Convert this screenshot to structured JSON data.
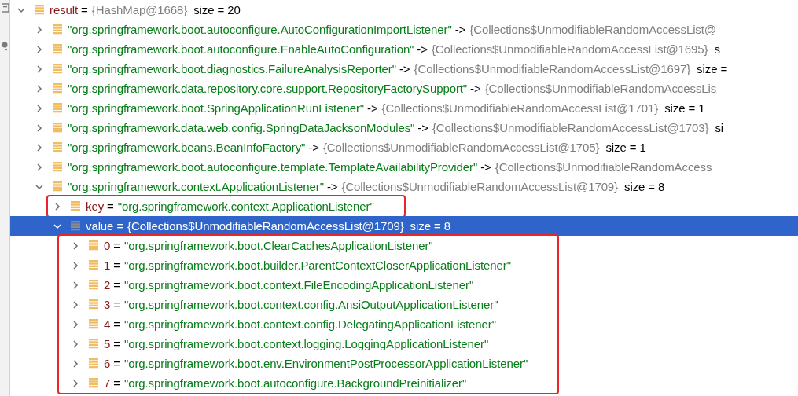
{
  "tree": {
    "name": "result",
    "kind": "object",
    "separator": "=",
    "value": "{HashMap@1668}",
    "size": "size = 20",
    "expanded": true,
    "selected": false,
    "highlighted": false,
    "children_highlighted": false,
    "children": [
      {
        "name": "\"org.springframework.boot.autoconfigure.AutoConfigurationImportListener\"",
        "kind": "entry",
        "separator": "->",
        "value": "{Collections$UnmodifiableRandomAccessList@",
        "expanded": false,
        "selected": false,
        "highlighted": false
      },
      {
        "name": "\"org.springframework.boot.autoconfigure.EnableAutoConfiguration\"",
        "kind": "entry",
        "separator": "->",
        "value": "{Collections$UnmodifiableRandomAccessList@1695}",
        "size": "s",
        "expanded": false,
        "selected": false,
        "highlighted": false
      },
      {
        "name": "\"org.springframework.boot.diagnostics.FailureAnalysisReporter\"",
        "kind": "entry",
        "separator": "->",
        "value": "{Collections$UnmodifiableRandomAccessList@1697}",
        "size": "size =",
        "expanded": false,
        "selected": false,
        "highlighted": false
      },
      {
        "name": "\"org.springframework.data.repository.core.support.RepositoryFactorySupport\"",
        "kind": "entry",
        "separator": "->",
        "value": "{Collections$UnmodifiableRandomAccessLis",
        "expanded": false,
        "selected": false,
        "highlighted": false
      },
      {
        "name": "\"org.springframework.boot.SpringApplicationRunListener\"",
        "kind": "entry",
        "separator": "->",
        "value": "{Collections$UnmodifiableRandomAccessList@1701}",
        "size": "size = 1",
        "expanded": false,
        "selected": false,
        "highlighted": false
      },
      {
        "name": "\"org.springframework.data.web.config.SpringDataJacksonModules\"",
        "kind": "entry",
        "separator": "->",
        "value": "{Collections$UnmodifiableRandomAccessList@1703}",
        "size": "si",
        "expanded": false,
        "selected": false,
        "highlighted": false
      },
      {
        "name": "\"org.springframework.beans.BeanInfoFactory\"",
        "kind": "entry",
        "separator": "->",
        "value": "{Collections$UnmodifiableRandomAccessList@1705}",
        "size": "size = 1",
        "expanded": false,
        "selected": false,
        "highlighted": false
      },
      {
        "name": "\"org.springframework.boot.autoconfigure.template.TemplateAvailabilityProvider\"",
        "kind": "entry",
        "separator": "->",
        "value": "{Collections$UnmodifiableRandomAccess",
        "expanded": false,
        "selected": false,
        "highlighted": false
      },
      {
        "name": "\"org.springframework.context.ApplicationListener\"",
        "kind": "entry",
        "separator": "->",
        "value": "{Collections$UnmodifiableRandomAccessList@1709}",
        "size": "size = 8",
        "expanded": true,
        "selected": false,
        "highlighted": false,
        "children_highlighted": false,
        "children": [
          {
            "name": "key",
            "kind": "field",
            "separator": "=",
            "value": "\"org.springframework.context.ApplicationListener\"",
            "expanded": false,
            "selected": false,
            "highlighted": true
          },
          {
            "name": "value",
            "kind": "object",
            "separator": "=",
            "value": "{Collections$UnmodifiableRandomAccessList@1709}",
            "size": "size = 8",
            "expanded": true,
            "selected": true,
            "highlighted": false,
            "children_highlighted": true,
            "children": [
              {
                "name": "0",
                "kind": "field",
                "separator": "=",
                "value": "\"org.springframework.boot.ClearCachesApplicationListener\"",
                "expanded": false,
                "selected": false,
                "highlighted": false
              },
              {
                "name": "1",
                "kind": "field",
                "separator": "=",
                "value": "\"org.springframework.boot.builder.ParentContextCloserApplicationListener\"",
                "expanded": false,
                "selected": false,
                "highlighted": false
              },
              {
                "name": "2",
                "kind": "field",
                "separator": "=",
                "value": "\"org.springframework.boot.context.FileEncodingApplicationListener\"",
                "expanded": false,
                "selected": false,
                "highlighted": false
              },
              {
                "name": "3",
                "kind": "field",
                "separator": "=",
                "value": "\"org.springframework.boot.context.config.AnsiOutputApplicationListener\"",
                "expanded": false,
                "selected": false,
                "highlighted": false
              },
              {
                "name": "4",
                "kind": "field",
                "separator": "=",
                "value": "\"org.springframework.boot.context.config.DelegatingApplicationListener\"",
                "expanded": false,
                "selected": false,
                "highlighted": false
              },
              {
                "name": "5",
                "kind": "field",
                "separator": "=",
                "value": "\"org.springframework.boot.context.logging.LoggingApplicationListener\"",
                "expanded": false,
                "selected": false,
                "highlighted": false
              },
              {
                "name": "6",
                "kind": "field",
                "separator": "=",
                "value": "\"org.springframework.boot.env.EnvironmentPostProcessorApplicationListener\"",
                "expanded": false,
                "selected": false,
                "highlighted": false
              },
              {
                "name": "7",
                "kind": "field",
                "separator": "=",
                "value": "\"org.springframework.boot.autoconfigure.BackgroundPreinitializer\"",
                "expanded": false,
                "selected": false,
                "highlighted": false
              }
            ]
          }
        ]
      }
    ]
  }
}
